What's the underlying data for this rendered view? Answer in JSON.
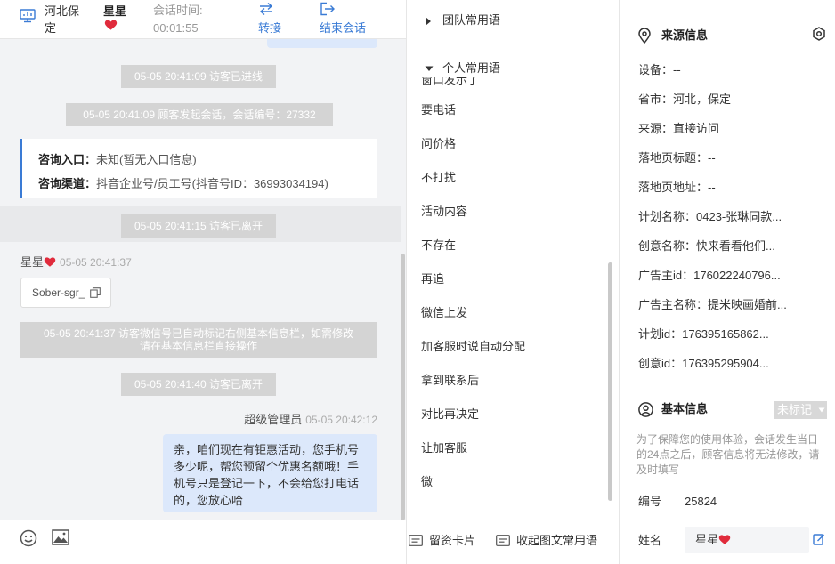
{
  "header": {
    "location": "河北保定",
    "visitor_name": "星星",
    "session_time_label": "会话时间:",
    "session_time_value": "00:01:55",
    "transfer_label": "转接",
    "end_session_label": "结束会话"
  },
  "chat": {
    "system_msgs": [
      "05-05 20:41:09 访客已进线",
      "05-05 20:41:09 顾客发起会话，会话编号：27332",
      "05-05 20:41:15 访客已离开",
      "05-05 20:41:37 访客微信号已自动标记右侧基本信息栏，如需修改\n请在基本信息栏直接操作",
      "05-05 20:41:40 访客已离开"
    ],
    "inquiry": {
      "entry_label": "咨询入口：",
      "entry_value": "未知(暂无入口信息)",
      "channel_label": "咨询渠道：",
      "channel_value": "抖音企业号/员工号(抖音号ID：36993034194)"
    },
    "visitor_msg": {
      "sender": "星星",
      "time": "05-05 20:41:37",
      "text": "Sober-sgr_"
    },
    "agent_msg": {
      "sender": "超级管理员",
      "time": "05-05 20:42:12",
      "text": "亲，咱们现在有钜惠活动，您手机号多少呢，帮您预留个优惠名额哦！手机号只是登记一下，不会给您打电话的，您放心哈"
    }
  },
  "phrases": {
    "team_group": "团队常用语",
    "personal_group": "个人常用语",
    "items": [
      "要电话",
      "问价格",
      "不打扰",
      "活动内容",
      "不存在",
      "再追",
      "微信上发",
      "加客服时说自动分配",
      "拿到联系后",
      "对比再决定",
      "让加客服",
      "微"
    ],
    "partial_top_item": "窗口发示了",
    "footer_card": "留资卡片",
    "footer_collapse": "收起图文常用语"
  },
  "info": {
    "source_title": "来源信息",
    "rows": [
      "设备：--",
      "省市：河北，保定",
      "来源：直接访问",
      "落地页标题：--",
      "落地页地址：--",
      "计划名称：0423-张琳同款...",
      "创意名称：快来看看他们...",
      "广告主id：176022240796...",
      "广告主名称：提米映画婚前...",
      "计划id：176395165862...",
      "创意id：176395295904..."
    ],
    "basic_title": "基本信息",
    "tag_label": "未标记",
    "basic_note": "为了保障您的使用体验，会话发生当日的24点之后，顾客信息将无法修改，请及时填写",
    "number_label": "编号",
    "number_value": "25824",
    "name_label": "姓名",
    "name_value": "星星"
  },
  "colors": {
    "accent": "#3a7bd5",
    "agent_bubble": "#dce8fb",
    "system_pill": "#d4d4d4",
    "heart": "#e02b3c"
  }
}
